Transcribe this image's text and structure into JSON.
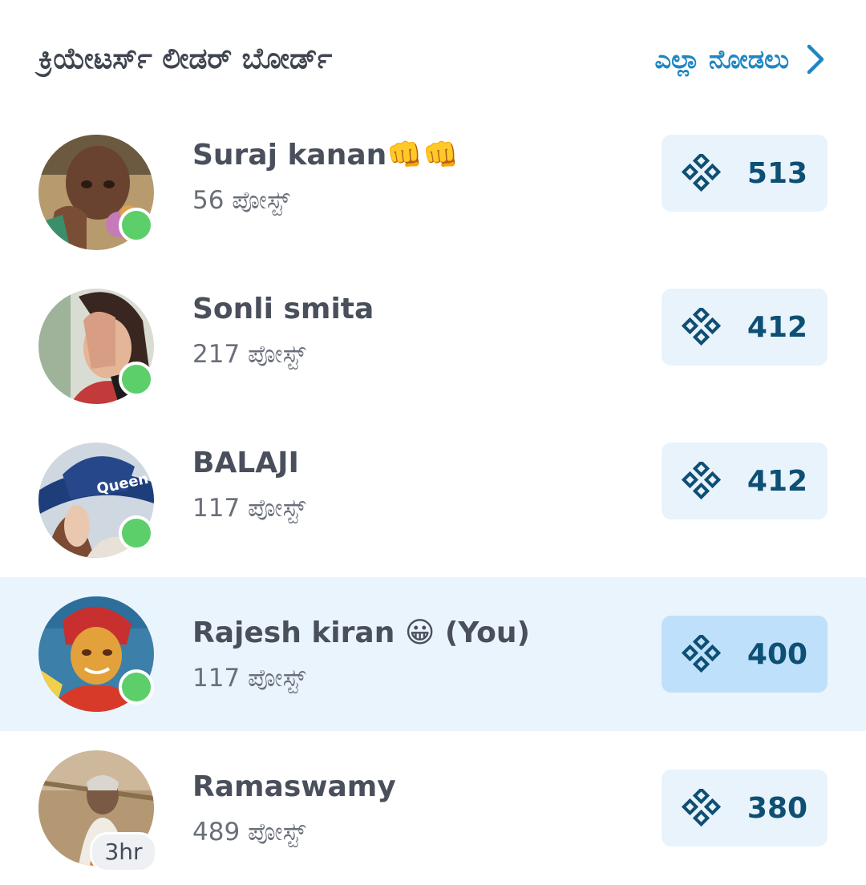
{
  "header": {
    "title": "ಕ್ರಿಯೇಟರ್ಸ್ ಲೀಡರ್ ಬೋರ್ಡ್",
    "see_all_label": "ಎಲ್ಲಾ ನೋಡಲು"
  },
  "colors": {
    "accent": "#1f86c2",
    "score_text": "#0e4f74",
    "score_bg": "#e9f3fb",
    "score_bg_current": "#bfe0fa",
    "current_row_bg": "#eaf4fd",
    "online": "#5ccf6a"
  },
  "leaderboard": [
    {
      "name": "Suraj kanan👊👊",
      "posts": "56 ಪೋಸ್ಟ್",
      "score": "513",
      "status": "online",
      "current_user": false
    },
    {
      "name": "Sonli smita",
      "posts": "217 ಪೋಸ್ಟ್",
      "score": "412",
      "status": "online",
      "current_user": false
    },
    {
      "name": "BALAJI",
      "posts": "117 ಪೋಸ್ಟ್",
      "score": "412",
      "status": "online",
      "current_user": false
    },
    {
      "name": "Rajesh kiran 😀 (You)",
      "posts": "117 ಪೋಸ್ಟ್",
      "score": "400",
      "status": "online",
      "current_user": true
    },
    {
      "name": "Ramaswamy",
      "posts": "489 ಪೋಸ್ಟ್",
      "score": "380",
      "status": "3hr",
      "current_user": false
    }
  ]
}
